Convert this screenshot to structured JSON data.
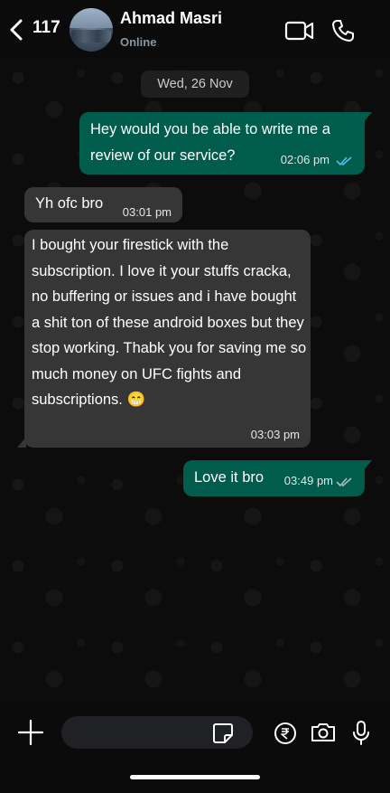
{
  "header": {
    "unread_count": "117",
    "contact_name": "Ahmad Masri",
    "status": "Online"
  },
  "chat": {
    "date_label": "Wed, 26 Nov",
    "messages": [
      {
        "direction": "outgoing",
        "text": "Hey would you be able to write me a review of our service?",
        "time": "02:06 pm",
        "status": "read"
      },
      {
        "direction": "incoming",
        "text": "Yh ofc bro",
        "time": "03:01 pm"
      },
      {
        "direction": "incoming",
        "text": " I bought your firestick with the subscription. I love it your stuffs cracka, no buffering or issues and i have bought a shit ton of these android boxes but they stop working. Thabk you for saving me so much money on UFC fights and subscriptions. 😁",
        "time": "03:03 pm"
      },
      {
        "direction": "outgoing",
        "text": "Love it bro",
        "time": "03:49 pm",
        "status": "delivered"
      }
    ]
  },
  "composer": {
    "placeholder": ""
  },
  "colors": {
    "outgoing_bubble": "#005c4b",
    "incoming_bubble": "#363636",
    "read_ticks": "#53bdeb",
    "delivered_ticks": "#aebac1"
  },
  "icons": [
    "back-arrow-icon",
    "video-call-icon",
    "phone-icon",
    "plus-icon",
    "sticker-icon",
    "rupee-icon",
    "camera-icon",
    "mic-icon"
  ]
}
